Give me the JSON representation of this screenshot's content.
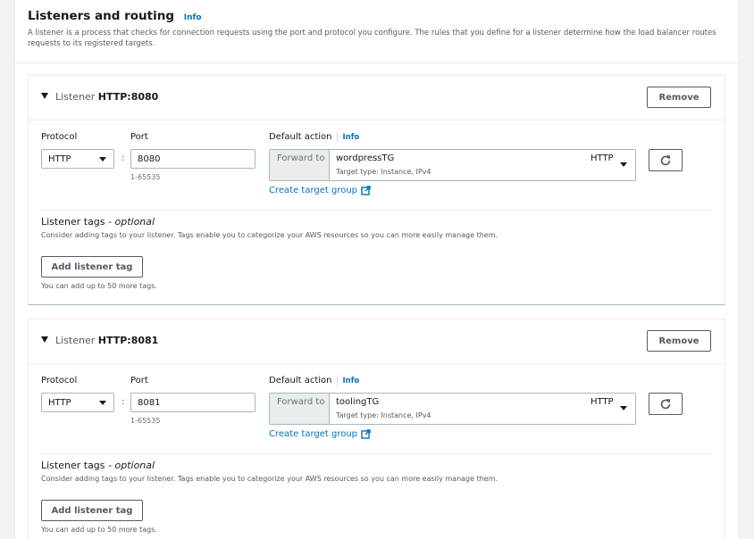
{
  "section": {
    "title": "Listeners and routing",
    "info": "Info",
    "description": "A listener is a process that checks for connection requests using the port and protocol you configure. The rules that you define for a listener determine how the load balancer routes requests to its registered targets."
  },
  "labels": {
    "listener_prefix": "Listener",
    "remove": "Remove",
    "protocol": "Protocol",
    "port": "Port",
    "default_action": "Default action",
    "info": "Info",
    "port_hint": "1-65535",
    "forward_to": "Forward to",
    "create_target_group": "Create target group",
    "tags_title": "Listener tags",
    "tags_optional": "- optional",
    "tags_desc": "Consider adding tags to your listener. Tags enable you to categorize your AWS resources so you can more easily manage them.",
    "add_tag": "Add listener tag",
    "tags_limit": "You can add up to 50 more tags."
  },
  "listeners": [
    {
      "name": "HTTP:8080",
      "protocol": "HTTP",
      "port": "8080",
      "target_group": "wordpressTG",
      "target_type": "Target type: Instance, IPv4",
      "target_protocol": "HTTP"
    },
    {
      "name": "HTTP:8081",
      "protocol": "HTTP",
      "port": "8081",
      "target_group": "toolingTG",
      "target_type": "Target type: Instance, IPv4",
      "target_protocol": "HTTP"
    }
  ],
  "icons": {
    "expand": "caret-down-icon",
    "refresh": "refresh-icon",
    "external": "external-link-icon"
  },
  "colors": {
    "link": "#0073bb",
    "text": "#16191f",
    "secondary": "#545b64",
    "border": "#aab7b8"
  }
}
